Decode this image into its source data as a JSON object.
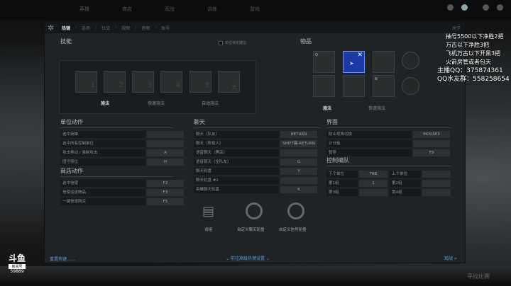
{
  "top_nav": [
    "英雄",
    "商店",
    "观战",
    "训练",
    "游戏"
  ],
  "tabs": [
    "热键",
    "选项",
    "社交",
    "视频",
    "音频",
    "账号"
  ],
  "about": "关于",
  "abilities": {
    "title": "技能",
    "unit_toggle": "单位特定键位",
    "slots": [
      "1",
      "2",
      "3",
      "4",
      "5",
      "大"
    ],
    "modes": [
      "施法",
      "快速施法",
      "自动施法"
    ]
  },
  "items": {
    "title": "物品",
    "slots": [
      "Q",
      "",
      "",
      "",
      "",
      "N"
    ],
    "modes": [
      "施法",
      "快速施法"
    ]
  },
  "unit_actions": {
    "title": "单位动作",
    "rows": [
      {
        "label": "选中英雄",
        "key": ""
      },
      {
        "label": "选中所有控制单位",
        "key": ""
      },
      {
        "label": "攻击移动 / 强制攻击",
        "key": "A"
      },
      {
        "label": "固守原位",
        "key": "H"
      }
    ]
  },
  "shop_actions": {
    "title": "商店动作",
    "rows": [
      {
        "label": "选中信使",
        "key": "F2"
      },
      {
        "label": "信使运送物品",
        "key": "F3"
      },
      {
        "label": "一键快速购买",
        "key": "F5"
      }
    ]
  },
  "chat": {
    "title": "聊天",
    "rows": [
      {
        "label": "聊天（队友）",
        "key": "RETURN"
      },
      {
        "label": "聊天（所有人）",
        "key": "SHIFT键-RETURN"
      },
      {
        "label": "语音聊天（黑店）",
        "key": ""
      },
      {
        "label": "语音聊天（全队友）",
        "key": "G"
      },
      {
        "label": "聊天轮盘",
        "key": "Y"
      },
      {
        "label": "聊天轮盘 #2",
        "key": ""
      },
      {
        "label": "英雄聊天轮盘",
        "key": "K"
      }
    ]
  },
  "interface": {
    "title": "界面",
    "rows": [
      {
        "label": "防止视角切换",
        "key": "MOUSE3"
      },
      {
        "label": "计分板",
        "key": ""
      },
      {
        "label": "暂停",
        "key": "F9"
      }
    ]
  },
  "control_groups": {
    "title": "控制编队",
    "rows": [
      {
        "l1": "下个单位",
        "k1": "TAB",
        "l2": "上个单位",
        "k2": ""
      },
      {
        "l1": "第1组",
        "k1": "1",
        "l2": "第2组",
        "k2": ""
      },
      {
        "l1": "第3组",
        "k1": "",
        "l2": "第4组",
        "k2": ""
      }
    ]
  },
  "bottom_icons": [
    "词组",
    "自定义聊天轮盘",
    "自定义信号轮盘"
  ],
  "footer": {
    "reset": "重置热键……",
    "advanced": "前往高级热键设置",
    "watch": "观战 »"
  },
  "stream_overlay": [
    "抽号5500以下净胜2把",
    "万古以下净胜3把",
    "飞机万古以下开黑3把",
    "火箭房管或者包天",
    "主播QQ：375874361",
    "QQ水友群：558258654"
  ],
  "logo": {
    "brand": "斗鱼",
    "room_label": "房间号",
    "room": "59889"
  },
  "bottom_bar": {
    "find_match": "寻找比赛"
  }
}
